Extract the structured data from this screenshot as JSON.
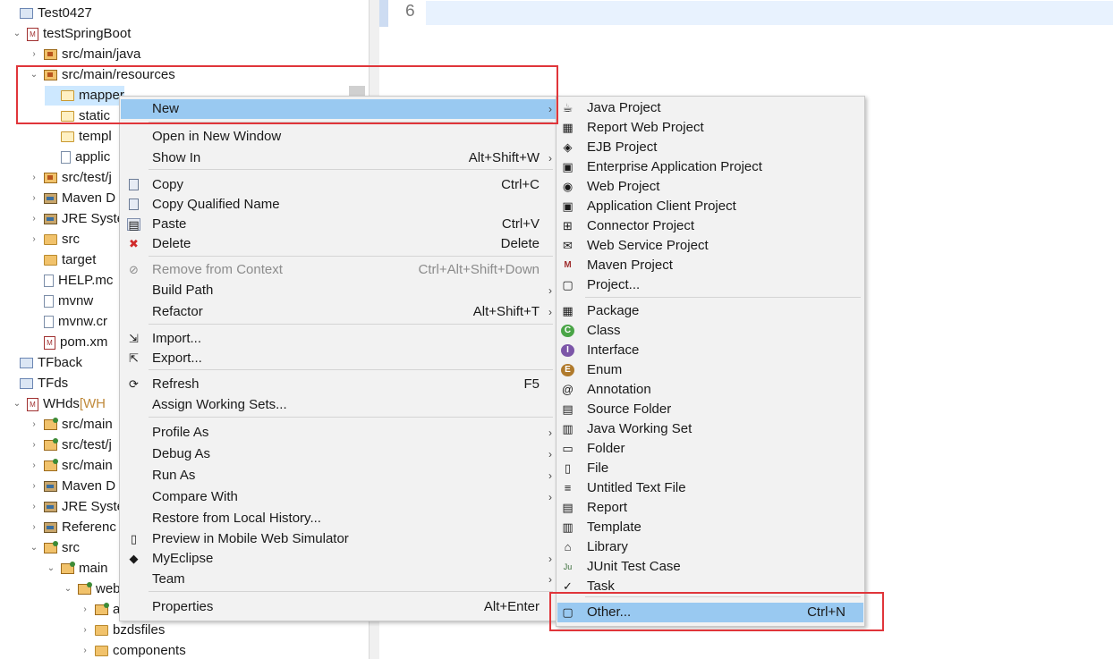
{
  "tree": {
    "rows": [
      {
        "label": "Test0427",
        "indent": 1,
        "twisty": "",
        "icon": "project"
      },
      {
        "label": "testSpringBoot",
        "indent": 0,
        "twisty": "⌄",
        "icon": "maven"
      },
      {
        "label": "src/main/java",
        "indent": 2,
        "twisty": "›",
        "icon": "pkg"
      },
      {
        "label": "src/main/resources",
        "indent": 2,
        "twisty": "⌄",
        "icon": "pkg"
      },
      {
        "label": "mapper",
        "indent": 3,
        "twisty": "",
        "icon": "folder-open"
      },
      {
        "label": "static",
        "indent": 3,
        "twisty": "",
        "icon": "folder-open"
      },
      {
        "label": "templ",
        "indent": 3,
        "twisty": "",
        "icon": "folder-open"
      },
      {
        "label": "applic",
        "indent": 3,
        "twisty": "",
        "icon": "file"
      },
      {
        "label": "src/test/j",
        "indent": 2,
        "twisty": "›",
        "icon": "pkg"
      },
      {
        "label": "Maven D",
        "indent": 2,
        "twisty": "›",
        "icon": "lib"
      },
      {
        "label": "JRE Syste",
        "indent": 2,
        "twisty": "›",
        "icon": "lib"
      },
      {
        "label": "src",
        "indent": 2,
        "twisty": "›",
        "icon": "folder"
      },
      {
        "label": "target",
        "indent": 2,
        "twisty": "",
        "icon": "folder"
      },
      {
        "label": "HELP.mc",
        "indent": 2,
        "twisty": "",
        "icon": "file"
      },
      {
        "label": "mvnw",
        "indent": 2,
        "twisty": "",
        "icon": "file"
      },
      {
        "label": "mvnw.cr",
        "indent": 2,
        "twisty": "",
        "icon": "file"
      },
      {
        "label": "pom.xm",
        "indent": 2,
        "twisty": "",
        "icon": "maven"
      },
      {
        "label": "TFback",
        "indent": 1,
        "twisty": "",
        "icon": "project"
      },
      {
        "label": "TFds",
        "indent": 1,
        "twisty": "",
        "icon": "project"
      },
      {
        "label": "WHds",
        "deco": " [WH",
        "indent": 0,
        "twisty": "⌄",
        "icon": "maven"
      },
      {
        "label": "src/main",
        "indent": 2,
        "twisty": "›",
        "icon": "spring"
      },
      {
        "label": "src/test/j",
        "indent": 2,
        "twisty": "›",
        "icon": "spring"
      },
      {
        "label": "src/main",
        "indent": 2,
        "twisty": "›",
        "icon": "spring"
      },
      {
        "label": "Maven D",
        "indent": 2,
        "twisty": "›",
        "icon": "lib"
      },
      {
        "label": "JRE Syste",
        "indent": 2,
        "twisty": "›",
        "icon": "lib"
      },
      {
        "label": "Referenc",
        "indent": 2,
        "twisty": "›",
        "icon": "lib"
      },
      {
        "label": "src",
        "indent": 2,
        "twisty": "⌄",
        "icon": "spring"
      },
      {
        "label": "main",
        "indent": 3,
        "twisty": "⌄",
        "icon": "spring"
      },
      {
        "label": "web",
        "indent": 4,
        "twisty": "⌄",
        "icon": "spring"
      },
      {
        "label": "a",
        "indent": 5,
        "twisty": "›",
        "icon": "spring"
      },
      {
        "label": "bzdsfiles",
        "indent": 5,
        "twisty": "›",
        "icon": "folder"
      },
      {
        "label": "components",
        "indent": 5,
        "twisty": "›",
        "icon": "folder"
      }
    ]
  },
  "editor": {
    "line_number": "6"
  },
  "context_menu": {
    "items": [
      {
        "type": "item",
        "label": "New",
        "shortcut": "",
        "submenu": true,
        "icon": "",
        "highlighted": true
      },
      {
        "type": "sep"
      },
      {
        "type": "item",
        "label": "Open in New Window",
        "shortcut": "",
        "submenu": false,
        "icon": ""
      },
      {
        "type": "item",
        "label": "Show In",
        "shortcut": "Alt+Shift+W",
        "submenu": true,
        "icon": ""
      },
      {
        "type": "sep"
      },
      {
        "type": "item",
        "label": "Copy",
        "shortcut": "Ctrl+C",
        "submenu": false,
        "icon": "copy"
      },
      {
        "type": "item",
        "label": "Copy Qualified Name",
        "shortcut": "",
        "submenu": false,
        "icon": "copy"
      },
      {
        "type": "item",
        "label": "Paste",
        "shortcut": "Ctrl+V",
        "submenu": false,
        "icon": "paste"
      },
      {
        "type": "item",
        "label": "Delete",
        "shortcut": "Delete",
        "submenu": false,
        "icon": "delete"
      },
      {
        "type": "sep"
      },
      {
        "type": "item",
        "label": "Remove from Context",
        "shortcut": "Ctrl+Alt+Shift+Down",
        "submenu": false,
        "icon": "remove",
        "disabled": true
      },
      {
        "type": "item",
        "label": "Build Path",
        "shortcut": "",
        "submenu": true,
        "icon": ""
      },
      {
        "type": "item",
        "label": "Refactor",
        "shortcut": "Alt+Shift+T",
        "submenu": true,
        "icon": ""
      },
      {
        "type": "sep"
      },
      {
        "type": "item",
        "label": "Import...",
        "shortcut": "",
        "submenu": false,
        "icon": "import"
      },
      {
        "type": "item",
        "label": "Export...",
        "shortcut": "",
        "submenu": false,
        "icon": "export"
      },
      {
        "type": "sep"
      },
      {
        "type": "item",
        "label": "Refresh",
        "shortcut": "F5",
        "submenu": false,
        "icon": "refresh"
      },
      {
        "type": "item",
        "label": "Assign Working Sets...",
        "shortcut": "",
        "submenu": false,
        "icon": ""
      },
      {
        "type": "sep"
      },
      {
        "type": "item",
        "label": "Profile As",
        "shortcut": "",
        "submenu": true,
        "icon": ""
      },
      {
        "type": "item",
        "label": "Debug As",
        "shortcut": "",
        "submenu": true,
        "icon": ""
      },
      {
        "type": "item",
        "label": "Run As",
        "shortcut": "",
        "submenu": true,
        "icon": ""
      },
      {
        "type": "item",
        "label": "Compare With",
        "shortcut": "",
        "submenu": true,
        "icon": ""
      },
      {
        "type": "item",
        "label": "Restore from Local History...",
        "shortcut": "",
        "submenu": false,
        "icon": ""
      },
      {
        "type": "item",
        "label": "Preview in Mobile Web Simulator",
        "shortcut": "",
        "submenu": false,
        "icon": "mobile"
      },
      {
        "type": "item",
        "label": "MyEclipse",
        "shortcut": "",
        "submenu": true,
        "icon": "myeclipse"
      },
      {
        "type": "item",
        "label": "Team",
        "shortcut": "",
        "submenu": true,
        "icon": ""
      },
      {
        "type": "sep"
      },
      {
        "type": "item",
        "label": "Properties",
        "shortcut": "Alt+Enter",
        "submenu": false,
        "icon": ""
      }
    ]
  },
  "new_submenu": {
    "items": [
      {
        "type": "item",
        "label": "Java Project",
        "icon": "java-project"
      },
      {
        "type": "item",
        "label": "Report Web Project",
        "icon": "report-web-project"
      },
      {
        "type": "item",
        "label": "EJB Project",
        "icon": "ejb-project"
      },
      {
        "type": "item",
        "label": "Enterprise Application Project",
        "icon": "ear-project"
      },
      {
        "type": "item",
        "label": "Web Project",
        "icon": "web-project"
      },
      {
        "type": "item",
        "label": "Application Client Project",
        "icon": "client-project"
      },
      {
        "type": "item",
        "label": "Connector Project",
        "icon": "connector-project"
      },
      {
        "type": "item",
        "label": "Web Service Project",
        "icon": "webservice-project"
      },
      {
        "type": "item",
        "label": "Maven Project",
        "icon": "maven-project"
      },
      {
        "type": "item",
        "label": "Project...",
        "icon": "project"
      },
      {
        "type": "sep"
      },
      {
        "type": "item",
        "label": "Package",
        "icon": "package"
      },
      {
        "type": "item",
        "label": "Class",
        "icon": "class"
      },
      {
        "type": "item",
        "label": "Interface",
        "icon": "interface"
      },
      {
        "type": "item",
        "label": "Enum",
        "icon": "enum"
      },
      {
        "type": "item",
        "label": "Annotation",
        "icon": "annotation"
      },
      {
        "type": "item",
        "label": "Source Folder",
        "icon": "source-folder"
      },
      {
        "type": "item",
        "label": "Java Working Set",
        "icon": "working-set"
      },
      {
        "type": "item",
        "label": "Folder",
        "icon": "folder"
      },
      {
        "type": "item",
        "label": "File",
        "icon": "file"
      },
      {
        "type": "item",
        "label": "Untitled Text File",
        "icon": "text-file"
      },
      {
        "type": "item",
        "label": "Report",
        "icon": "report"
      },
      {
        "type": "item",
        "label": "Template",
        "icon": "template"
      },
      {
        "type": "item",
        "label": "Library",
        "icon": "library"
      },
      {
        "type": "item",
        "label": "JUnit Test Case",
        "icon": "junit"
      },
      {
        "type": "item",
        "label": "Task",
        "icon": "task"
      },
      {
        "type": "sep"
      },
      {
        "type": "item",
        "label": "Other...",
        "shortcut": "Ctrl+N",
        "icon": "other",
        "highlighted": true
      }
    ]
  },
  "colors": {
    "highlight": "#99c9f1",
    "annotation_box": "#e0353a",
    "menu_bg": "#f2f2f2"
  }
}
